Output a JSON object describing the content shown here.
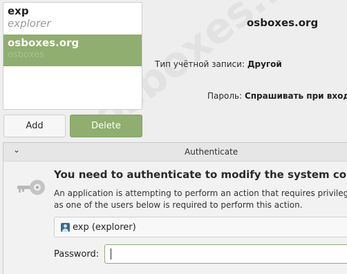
{
  "users": [
    {
      "username": "exp",
      "realname": "explorer"
    },
    {
      "username": "osboxes.org",
      "realname": "osboxes"
    }
  ],
  "buttons": {
    "add": "Add",
    "delete": "Delete"
  },
  "info": {
    "name": "osboxes.org",
    "account_type_label": "Тип учётной записи:",
    "account_type_value": "Другой",
    "password_label": "Пароль:",
    "password_value": "Спрашивать при входе"
  },
  "watermark": "osboxes.net",
  "dialog": {
    "title": "Authenticate",
    "heading": "You need to authenticate to modify the system configuration",
    "desc1": "An application is attempting to perform an action that requires privileges. Authentication",
    "desc2": "as one of the users below is required to perform this action.",
    "selected_user": "exp (explorer)",
    "password_label": "Password:",
    "password_value": ""
  },
  "colors": {
    "accent": "#8fae6f",
    "background": "#eeeeee"
  },
  "icons": {
    "collapse": "chevron-down-icon",
    "auth": "key-icon",
    "user": "user-avatar-icon"
  }
}
